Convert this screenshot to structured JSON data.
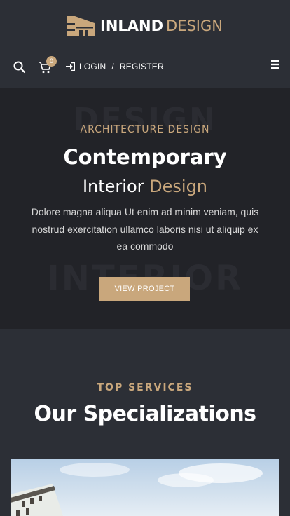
{
  "header": {
    "logo_word1": "INLAND",
    "logo_word2": "DESIGN",
    "cart_count": "0",
    "login_label": "LOGIN",
    "separator": "/",
    "register_label": "REGISTER"
  },
  "hero": {
    "kicker": "ARCHITECTURE DESIGN",
    "title": "Contemporary",
    "subtitle_part1": "Interior",
    "subtitle_part2": "Design",
    "body": "Dolore magna aliqua Ut enim ad minim veniam, quis nostrud exercitation ullamco laboris nisi ut aliquip ex ea commodo",
    "button_label": "VIEW PROJECT",
    "ghost_top": "DESIGN",
    "ghost_bottom": "INTERIOR"
  },
  "services": {
    "kicker": "TOP SERVICES",
    "title": "Our Specializations"
  },
  "colors": {
    "accent": "#c9a77c",
    "background": "#2c2f36",
    "hero_background": "#222328"
  },
  "icons": [
    "search-icon",
    "cart-icon",
    "login-icon",
    "menu-icon"
  ]
}
